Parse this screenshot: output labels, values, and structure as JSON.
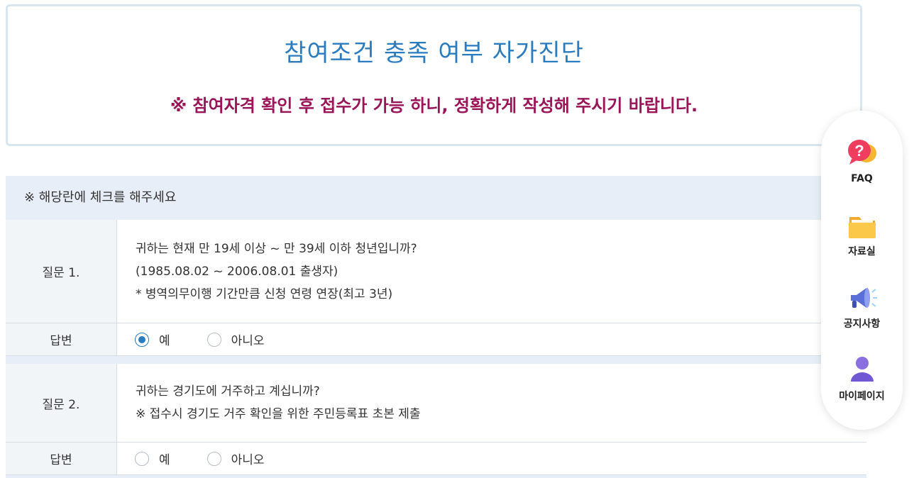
{
  "header": {
    "title": "참여조건 충족 여부 자가진단",
    "notice": "※ 참여자격 확인 후 접수가 가능 하니, 정확하게 작성해 주시기 바랍니다."
  },
  "instruction": "※ 해당란에 체크를 해주세요",
  "questions": [
    {
      "label": "질문 1.",
      "lines": [
        "귀하는 현재 만 19세 이상 ~ 만 39세 이하 청년입니까?",
        "(1985.08.02 ~ 2006.08.01 출생자)",
        "* 병역의무이행 기간만큼 신청 연령 연장(최고 3년)"
      ],
      "answer_label": "답변",
      "options": [
        "예",
        "아니오"
      ],
      "selected": "예"
    },
    {
      "label": "질문 2.",
      "lines": [
        "귀하는 경기도에 거주하고 계십니까?",
        "※ 접수시 경기도 거주 확인을 위한 주민등록표 초본 제출"
      ],
      "answer_label": "답변",
      "options": [
        "예",
        "아니오"
      ],
      "selected": ""
    }
  ],
  "floating_menu": [
    {
      "label": "FAQ",
      "icon": "faq-speech-bubble-icon"
    },
    {
      "label": "자료실",
      "icon": "folder-icon"
    },
    {
      "label": "공지사항",
      "icon": "megaphone-icon"
    },
    {
      "label": "마이페이지",
      "icon": "user-icon"
    }
  ],
  "colors": {
    "title": "#2b7bbf",
    "notice": "#9a1458",
    "instruction_bg": "#e7eef7",
    "radio_checked": "#2b7bbf"
  }
}
